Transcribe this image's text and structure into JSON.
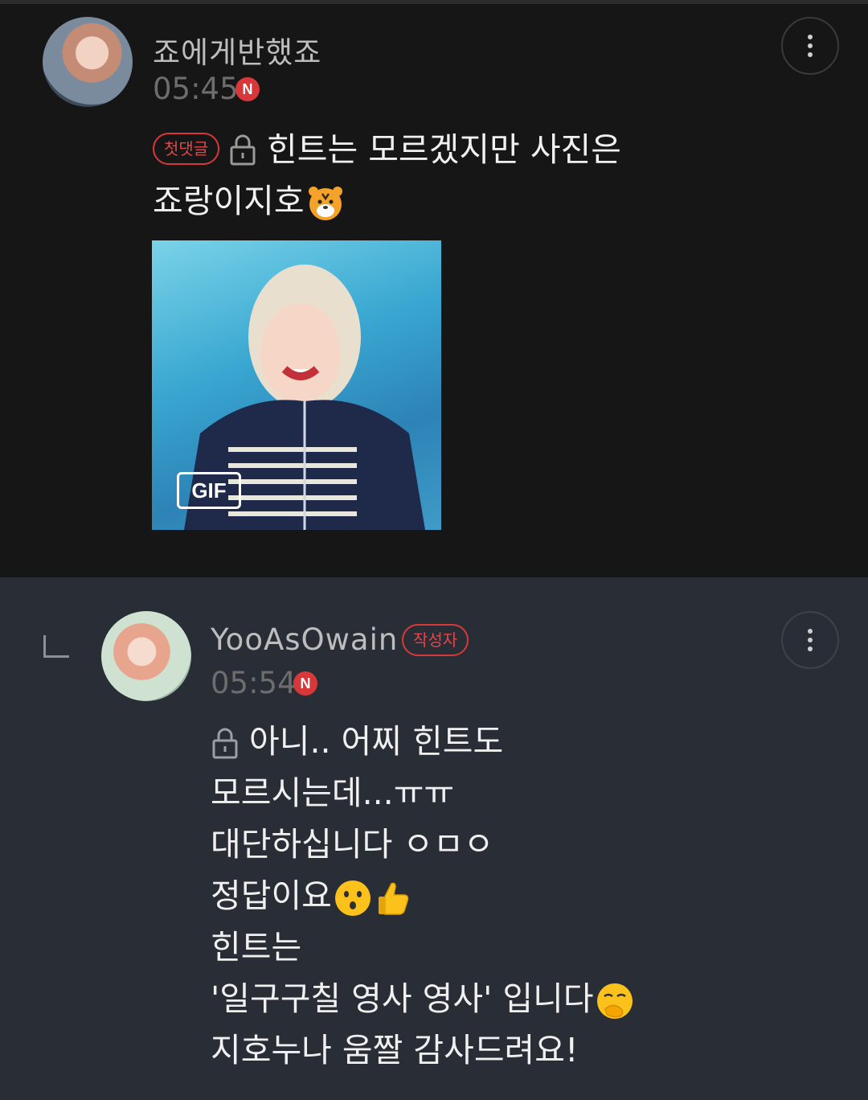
{
  "comments": [
    {
      "username": "죠에게반했죠",
      "time": "05:45",
      "new_badge": "N",
      "first_comment_chip": "첫댓글",
      "text_line_1": "힌트는 모르겠지만 사진은",
      "text_line_2": "죠랑이지호",
      "attachment_label": "GIF",
      "emoji": [
        "tiger-face"
      ]
    },
    {
      "username": "YooAsOwain",
      "author_chip": "작성자",
      "time": "05:54",
      "new_badge": "N",
      "lines": [
        "아니.. 어찌 힌트도",
        "모르시는데...ㅠㅠ",
        "대단하십니다 ㅇㅁㅇ",
        "정답이요",
        "힌트는",
        "'일구구칠 영사 영사' 입니다",
        "지호누나 움짤 감사드려요!"
      ],
      "emoji": [
        "hushed-face",
        "thumbs-up",
        "face-with-hand-over-mouth"
      ]
    }
  ],
  "colors": {
    "background_top": "#161616",
    "background_reply": "#282d36",
    "accent_red": "#d9383a",
    "muted_text": "#6d6d6d",
    "username_text": "#bdbdbd"
  },
  "icons": [
    "lock-icon",
    "more-vertical-icon",
    "reply-arrow-icon",
    "new-badge-icon"
  ]
}
